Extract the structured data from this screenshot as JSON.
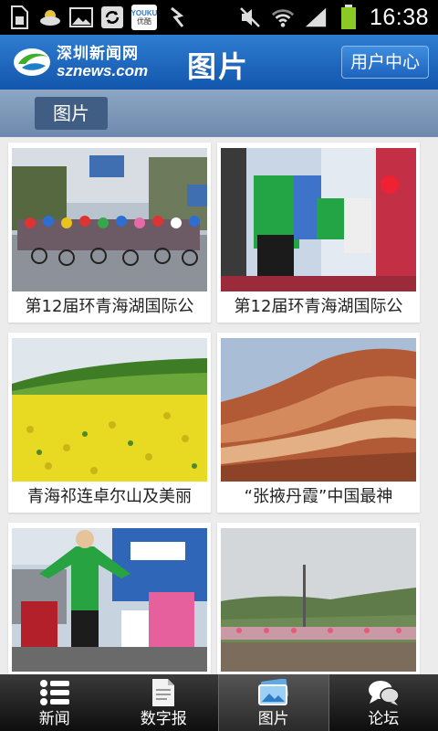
{
  "status_bar": {
    "time": "16:38",
    "youku_top": "YOUKU",
    "youku_bottom": "优酷",
    "icons": [
      "sim-icon",
      "weather-icon",
      "gallery-icon",
      "sync-icon",
      "youku-icon",
      "usb-icon",
      "mute-icon",
      "wifi-icon",
      "signal-icon",
      "battery-icon"
    ]
  },
  "header": {
    "logo_cn": "深圳新闻网",
    "logo_en": "sznews.com",
    "title": "图片",
    "user_center_label": "用户中心",
    "colors": {
      "header": "#1b62b8",
      "subbar": "#7d98ba",
      "active_tab": "#405d84"
    }
  },
  "sub_tab": {
    "label": "图片"
  },
  "gallery": {
    "items": [
      {
        "caption": "第12届环青海湖国际公",
        "scene": "cycling-race-peloton"
      },
      {
        "caption": "第12届环青海湖国际公",
        "scene": "cyclists-podium"
      },
      {
        "caption": "青海祁连卓尔山及美丽",
        "scene": "rapeseed-field"
      },
      {
        "caption": "“张掖丹霞”中国最神",
        "scene": "danxia-landform"
      },
      {
        "caption": "",
        "scene": "cyclist-winner"
      },
      {
        "caption": "",
        "scene": "grassland-flag"
      }
    ]
  },
  "bottom_nav": {
    "items": [
      {
        "label": "新闻",
        "icon": "list-icon"
      },
      {
        "label": "数字报",
        "icon": "newspaper-icon"
      },
      {
        "label": "图片",
        "icon": "picture-icon",
        "active": true
      },
      {
        "label": "论坛",
        "icon": "forum-icon"
      }
    ]
  }
}
